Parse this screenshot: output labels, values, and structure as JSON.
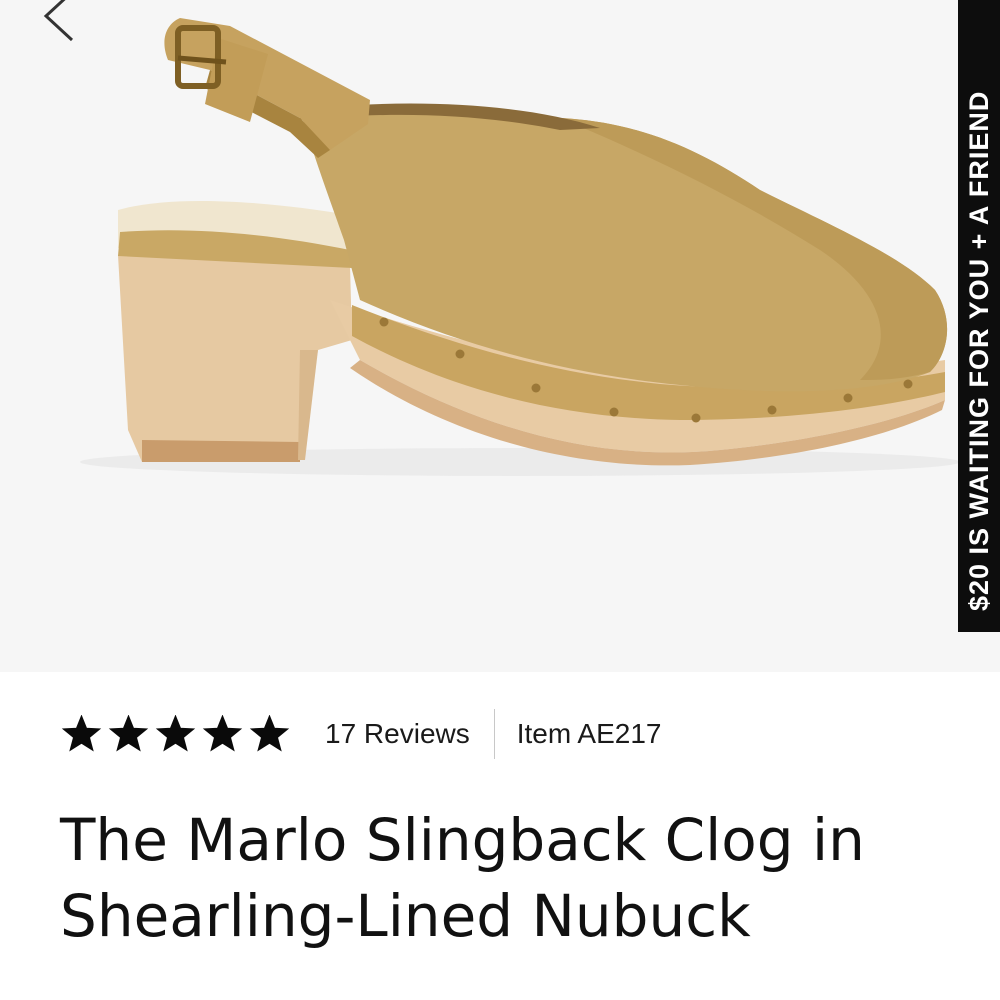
{
  "navigation": {
    "back_icon": "chevron-left-icon"
  },
  "product_image": {
    "subject": "slingback clog"
  },
  "promo_banner": {
    "text": "$20 IS WAITING FOR YOU + A FRIEND"
  },
  "rating": {
    "stars": 5,
    "max_stars": 5,
    "star_icon": "star-icon",
    "reviews_label": "17 Reviews"
  },
  "item": {
    "code_label": "Item AE217"
  },
  "product": {
    "title_line1": "The Marlo Slingback Clog in",
    "title_line2": "Shearling-Lined Nubuck"
  },
  "colors": {
    "hero_background": "#f6f6f6",
    "suede": "#c7a766",
    "wood": "#e8c9a0",
    "banner": "#0d0d0d",
    "text": "#111111"
  }
}
